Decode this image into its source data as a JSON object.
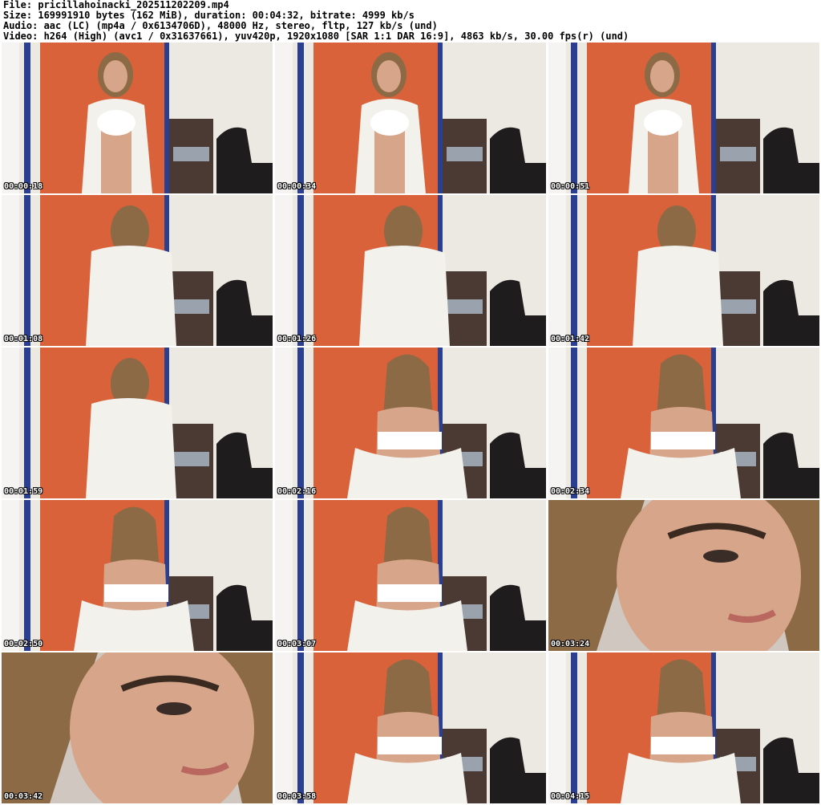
{
  "info": {
    "file": "File: pricillahoinacki_202511202209.mp4",
    "size": "Size: 169991910 bytes (162 MiB), duration: 00:04:32, bitrate: 4999 kb/s",
    "audio": "Audio: aac (LC) (mp4a / 0x6134706D), 48000 Hz, stereo, fltp, 127 kb/s (und)",
    "video": "Video: h264 (High) (avc1 / 0x31637661), yuv420p, 1920x1080 [SAR 1:1 DAR 16:9], 4863 kb/s, 30.00 fps(r) (und)"
  },
  "colors": {
    "orange_wall": "#d9623a",
    "white_wall": "#ece8e2",
    "blue_frame": "#2a3f8f",
    "chair": "#1e1c1c",
    "shirt": "#f3f1ec",
    "hair": "#8c6a45",
    "skin": "#d7a58a"
  },
  "thumbnails": [
    {
      "time": "00:00:18",
      "scene": "front-standing"
    },
    {
      "time": "00:00:34",
      "scene": "front-standing"
    },
    {
      "time": "00:00:51",
      "scene": "front-standing"
    },
    {
      "time": "00:01:08",
      "scene": "back-shirt"
    },
    {
      "time": "00:01:26",
      "scene": "back-shirt"
    },
    {
      "time": "00:01:42",
      "scene": "back-shirt"
    },
    {
      "time": "00:01:59",
      "scene": "back-shirt"
    },
    {
      "time": "00:02:16",
      "scene": "back-open"
    },
    {
      "time": "00:02:34",
      "scene": "back-open"
    },
    {
      "time": "00:02:50",
      "scene": "back-open"
    },
    {
      "time": "00:03:07",
      "scene": "back-open"
    },
    {
      "time": "00:03:24",
      "scene": "closeup-face"
    },
    {
      "time": "00:03:42",
      "scene": "closeup-face"
    },
    {
      "time": "00:03:58",
      "scene": "back-open"
    },
    {
      "time": "00:04:15",
      "scene": "back-open"
    }
  ]
}
